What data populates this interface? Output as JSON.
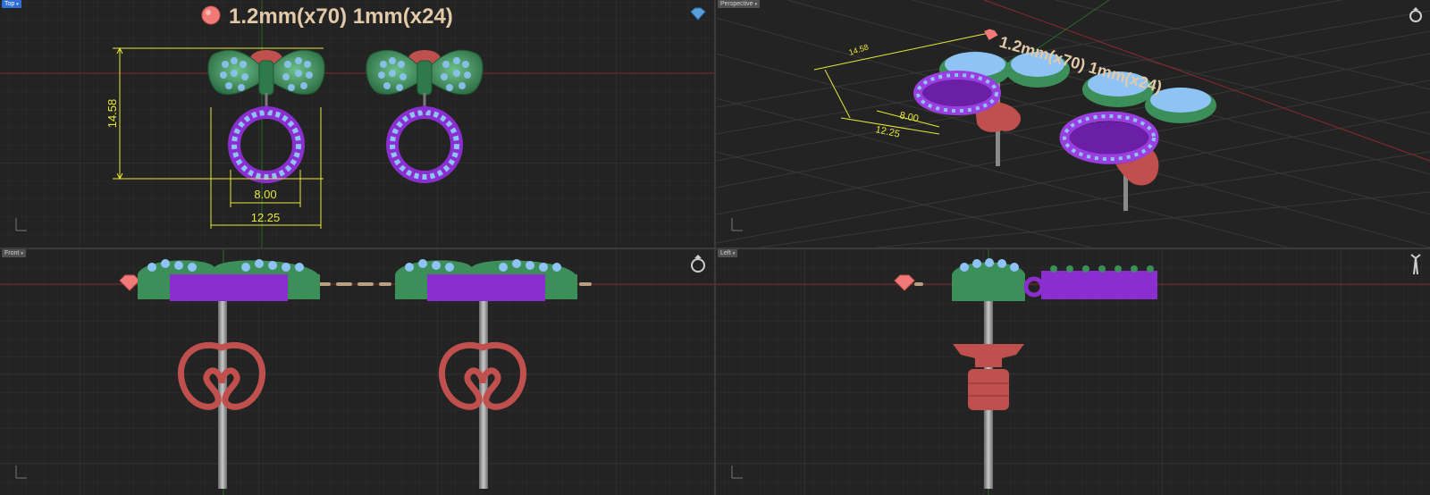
{
  "viewports": {
    "top": {
      "label": "Top"
    },
    "perspective": {
      "label": "Perspective"
    },
    "front": {
      "label": "Front"
    },
    "left": {
      "label": "Left"
    }
  },
  "annotation": {
    "stone_text": "1.2mm(x70) 1mm(x24)",
    "dim_height": "14.58",
    "dim_inner": "8.00",
    "dim_outer": "12.25"
  },
  "colors": {
    "background": "#232323",
    "grid": "#2e2e2e",
    "grid_major": "#3a3a3a",
    "axis_x": "#8a2a2a",
    "axis_y": "#2a6a2a",
    "dimension": "#e8e83a",
    "annotation_text": "#e2c9a8",
    "bow_green": "#3d8f5a",
    "stone_blue": "#8fc3f5",
    "ring_purple": "#8a2ed0",
    "post_gray": "#9a9a9a",
    "backing_red": "#c0504d",
    "gem_pink": "#f07a78",
    "active_tab": "#2f6fd8"
  },
  "icons": [
    "gem-icon",
    "ring-icon",
    "tweezers-icon",
    "axis-icon"
  ]
}
